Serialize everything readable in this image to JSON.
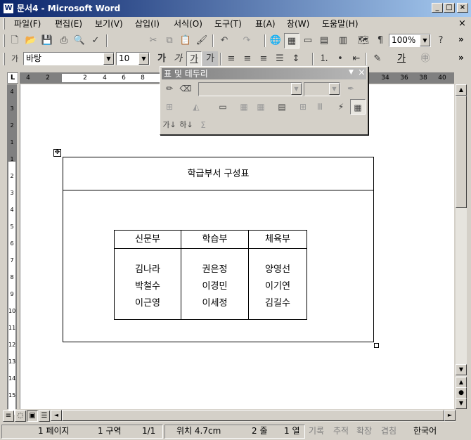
{
  "window": {
    "title": "문서4 - Microsoft Word",
    "app_icon": "W",
    "controls": {
      "minimize": "_",
      "maximize": "□",
      "close": "×"
    },
    "doc_close": "×"
  },
  "menu": [
    "파일(F)",
    "편집(E)",
    "보기(V)",
    "삽입(I)",
    "서식(O)",
    "도구(T)",
    "표(A)",
    "창(W)",
    "도움말(H)"
  ],
  "standard_toolbar": {
    "zoom": "100%",
    "help": "?",
    "more": "»"
  },
  "formatting_toolbar": {
    "style_icon": "가",
    "font": "바탕",
    "size": "10",
    "bold": "가",
    "italic": "가",
    "underline": "가",
    "charshade": "가",
    "fontcolor": "가",
    "more": "»"
  },
  "ruler": {
    "ticks": [
      "4",
      "2",
      "2",
      "4",
      "6",
      "8",
      "34",
      "36",
      "38",
      "40"
    ],
    "corner": "L"
  },
  "vruler_numbers": [
    "4",
    "3",
    "2",
    "1",
    "1",
    "2",
    "3",
    "4",
    "5",
    "6",
    "7",
    "8",
    "9",
    "10",
    "11",
    "12",
    "13",
    "14",
    "15"
  ],
  "float_toolbar": {
    "title": "표 및 테두리",
    "sort_asc": "가↓",
    "sort_desc": "하↓",
    "sum": "Σ"
  },
  "document": {
    "table_title": "학급부서 구성표",
    "headers": [
      "신문부",
      "학습부",
      "체육부"
    ],
    "columns": [
      [
        "김나라",
        "박철수",
        "이근영"
      ],
      [
        "권은정",
        "이경민",
        "이세정"
      ],
      [
        "양영선",
        "이기연",
        "김길수"
      ]
    ]
  },
  "status": {
    "page": "1 페이지",
    "section": "1 구역",
    "pages": "1/1",
    "position": "위치 4.7cm",
    "line": "2 줄",
    "col": "1 열",
    "rec": "기록",
    "trk": "추적",
    "ext": "확장",
    "ovr": "겹침",
    "lang": "한국어"
  }
}
